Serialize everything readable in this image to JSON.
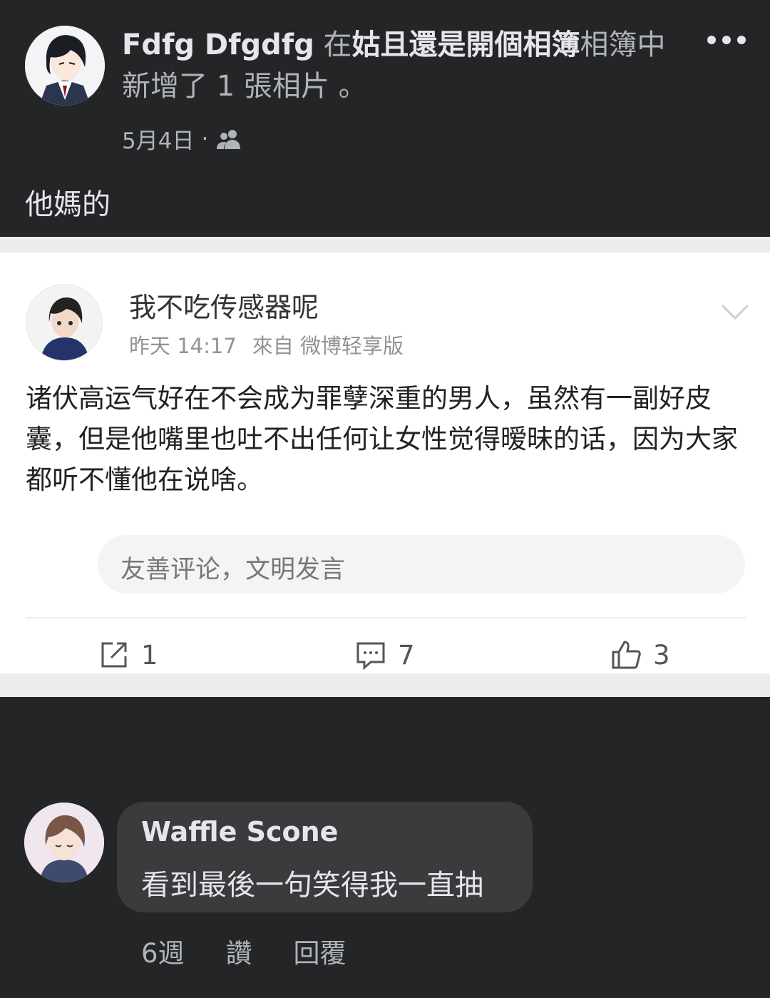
{
  "post": {
    "author": "Fdfg Dfgdfg",
    "in_word": " 在",
    "album_name": "姑且還是開個相簿",
    "album_suffix": "相簿中",
    "action_line": "新增了 1 張相片 。",
    "date": "5月4日",
    "dot": "·",
    "audience_icon": "friends-icon",
    "body": "他媽的",
    "more_icon": "more-dots-icon"
  },
  "weibo": {
    "username": "我不吃传感器呢",
    "time": "昨天 14:17",
    "source": "來自 微博轻享版",
    "text": "诸伏高运气好在不会成为罪孽深重的男人，虽然有一副好皮囊，但是他嘴里也吐不出任何让女性觉得暧昧的话，因为大家都听不懂他在说啥。",
    "comment_placeholder": "友善评论，文明发言",
    "share_count": "1",
    "comment_count": "7",
    "like_count": "3"
  },
  "comment": {
    "author": "Waffle Scone",
    "text": "看到最後一句笑得我一直抽",
    "age": "6週",
    "like_label": "讚",
    "reply_label": "回覆"
  }
}
